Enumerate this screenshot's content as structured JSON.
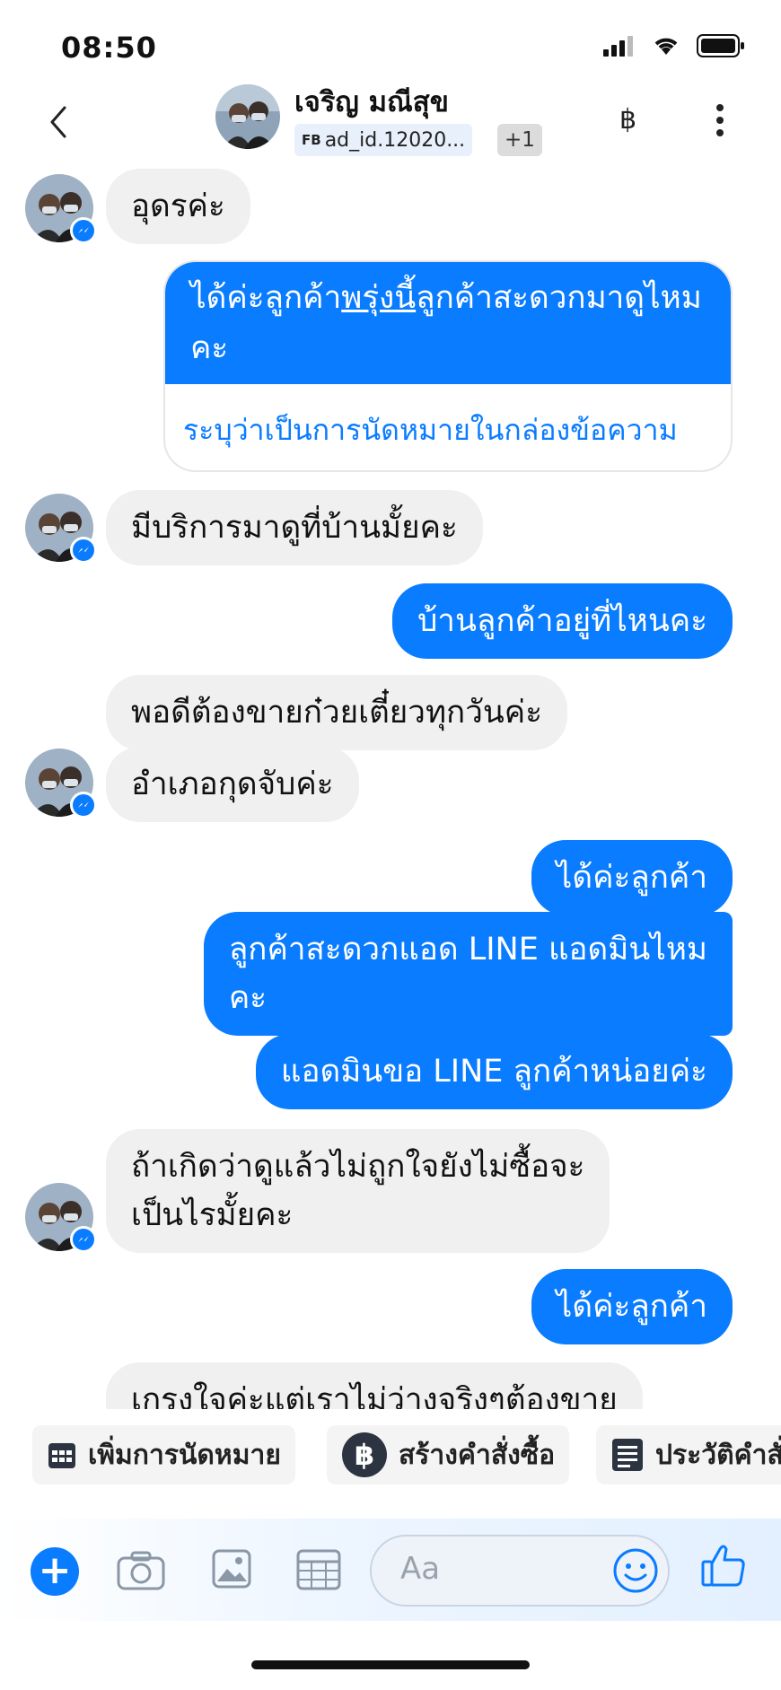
{
  "status": {
    "time": "08:50"
  },
  "header": {
    "name": "เจริญ มณีสุข",
    "tag_prefix": "FB",
    "tag": "ad_id.12020...",
    "extra": "+1",
    "baht_icon": "baht-icon"
  },
  "messages": [
    {
      "side": "in",
      "text": "อุดรค่ะ"
    },
    {
      "side": "out",
      "text_part1": "ได้ค่ะลูกค้า",
      "text_underlined": "พรุ่งนี้",
      "text_part2": "ลูกค้าสะดวกมาดูไหมคะ",
      "link": "ระบุว่าเป็นการนัดหมายในกล่องข้อความ"
    },
    {
      "side": "in",
      "text": "มีบริการมาดูที่บ้านมั้ยคะ"
    },
    {
      "side": "out",
      "text": "บ้านลูกค้าอยู่ที่ไหนคะ"
    },
    {
      "side": "in",
      "text": "พอดีต้องขายก๋วยเตี๋ยวทุกวันค่ะ"
    },
    {
      "side": "in",
      "text": "อำเภอกุดจับค่ะ"
    },
    {
      "side": "out",
      "text": "ได้ค่ะลูกค้า"
    },
    {
      "side": "out",
      "line1": "ลูกค้าสะดวกแอด LINE แอดมินไหม",
      "line2": "คะ"
    },
    {
      "side": "out",
      "text": "แอดมินขอ LINE ลูกค้าหน่อยค่ะ"
    },
    {
      "side": "in",
      "line1": "ถ้าเกิดว่าดูแล้วไม่ถูกใจยังไม่ซื้อจะ",
      "line2": "เป็นไรมั้ยคะ"
    },
    {
      "side": "out",
      "text": "ได้ค่ะลูกค้า"
    },
    {
      "side": "in",
      "text": "เกรงใจค่ะแต่เราไม่ว่างจริงๆต้องขาย"
    }
  ],
  "quick_actions": [
    {
      "label": "เพิ่มการนัดหมาย",
      "icon": "calendar-icon"
    },
    {
      "label": "สร้างคำสั่งซื้อ",
      "icon": "baht-circle-icon"
    },
    {
      "label": "ประวัติคำสั่งซื้อ",
      "icon": "receipt-icon"
    }
  ],
  "composer": {
    "placeholder": "Aa"
  },
  "colors": {
    "accent": "#0a7cff",
    "incoming": "#f0f0f0"
  }
}
